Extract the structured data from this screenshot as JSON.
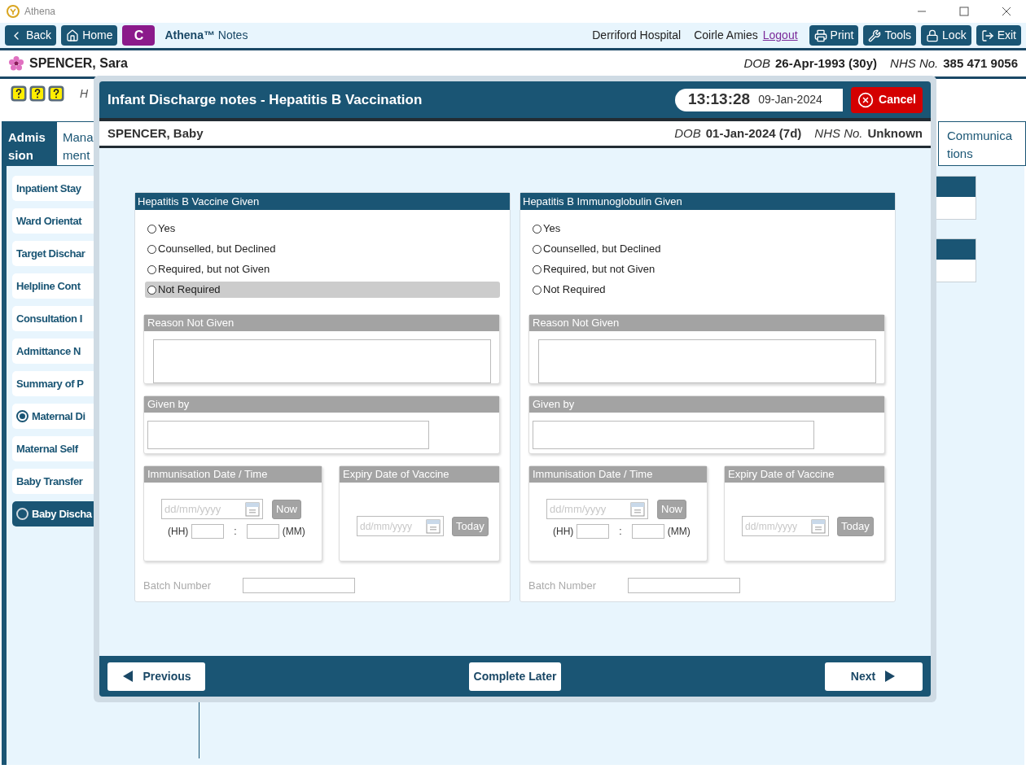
{
  "app": {
    "title": "Athena"
  },
  "toolbar": {
    "back": "Back",
    "home": "Home",
    "badge": "C",
    "app_name": "Athena™",
    "app_suffix": "Notes",
    "hospital": "Derriford Hospital",
    "user": "Coirle Amies",
    "logout": "Logout",
    "actions": [
      {
        "kind": "print",
        "label": "Print"
      },
      {
        "kind": "tools",
        "label": "Tools"
      },
      {
        "kind": "lock",
        "label": "Lock"
      },
      {
        "kind": "exit",
        "label": "Exit"
      }
    ]
  },
  "patient": {
    "name": "SPENCER, Sara",
    "dob_label": "DOB",
    "dob": "26-Apr-1993 (30y)",
    "nhs_label": "NHS No.",
    "nhs": "385 471 9056"
  },
  "info_row": {
    "text": "H"
  },
  "tabs": [
    {
      "lines": [
        "Admis",
        "sion"
      ],
      "selected": true
    },
    {
      "lines": [
        "Mana",
        "ment"
      ],
      "selected": false
    }
  ],
  "right_tab": {
    "lines": [
      "Communica",
      "tions"
    ],
    "selected": false
  },
  "sidebar": {
    "items": [
      {
        "kind": "plain",
        "label": "Inpatient Stay",
        "selected": false
      },
      {
        "kind": "plain",
        "label": "Ward Orientat",
        "selected": false
      },
      {
        "kind": "plain",
        "label": "Target Dischar",
        "selected": false
      },
      {
        "kind": "plain",
        "label": "Helpline Cont",
        "selected": false
      },
      {
        "kind": "plain",
        "label": "Consultation I",
        "selected": false
      },
      {
        "kind": "plain",
        "label": "Admittance N",
        "selected": false
      },
      {
        "kind": "plain",
        "label": "Summary of P",
        "selected": false
      },
      {
        "kind": "radio",
        "label": "Maternal Di",
        "checked": true,
        "selected": false
      },
      {
        "kind": "plain",
        "label": "Maternal Self",
        "selected": false
      },
      {
        "kind": "plain",
        "label": "Baby Transfer",
        "selected": false
      },
      {
        "kind": "radio",
        "label": "Baby Discha",
        "checked": false,
        "selected": true
      }
    ]
  },
  "modal": {
    "title": "Infant Discharge notes - Hepatitis B Vaccination",
    "time": "13:13:28",
    "date": "09-Jan-2024",
    "cancel": "Cancel",
    "baby": {
      "name": "SPENCER, Baby",
      "dob_label": "DOB",
      "dob": "01-Jan-2024 (7d)",
      "nhs_label": "NHS No.",
      "nhs": "Unknown"
    },
    "sections": [
      {
        "title": "Hepatitis B Vaccine Given",
        "details_disabled": true,
        "options": [
          {
            "label": "Yes",
            "selected": false,
            "focused": false
          },
          {
            "label": "Counselled, but Declined",
            "selected": false,
            "focused": false
          },
          {
            "label": "Required, but not Given",
            "selected": false,
            "focused": false
          },
          {
            "label": "Not Required",
            "selected": false,
            "focused": true
          }
        ],
        "reason_label": "Reason Not Given",
        "given_by_label": "Given by",
        "immunisation_label": "Immunisation Date / Time",
        "date_placeholder": "dd/mm/yyyy",
        "now": "Now",
        "hh": "(HH)",
        "colon": ":",
        "mm": "(MM)",
        "expiry_label": "Expiry Date of Vaccine",
        "expiry_placeholder": "dd/mm/yyyy",
        "today": "Today",
        "batch_label": "Batch Number"
      },
      {
        "title": "Hepatitis B Immunoglobulin Given",
        "details_disabled": true,
        "options": [
          {
            "label": "Yes",
            "selected": false,
            "focused": false
          },
          {
            "label": "Counselled, but Declined",
            "selected": false,
            "focused": false
          },
          {
            "label": "Required, but not Given",
            "selected": false,
            "focused": false
          },
          {
            "label": "Not Required",
            "selected": false,
            "focused": false
          }
        ],
        "reason_label": "Reason Not Given",
        "given_by_label": "Given by",
        "immunisation_label": "Immunisation Date / Time",
        "date_placeholder": "dd/mm/yyyy",
        "now": "Now",
        "hh": "(HH)",
        "colon": ":",
        "mm": "(MM)",
        "expiry_label": "Expiry Date of Vaccine",
        "expiry_placeholder": "dd/mm/yyyy",
        "today": "Today",
        "batch_label": "Batch Number"
      }
    ],
    "footer": {
      "previous": "Previous",
      "complete": "Complete Later",
      "next": "Next"
    }
  }
}
